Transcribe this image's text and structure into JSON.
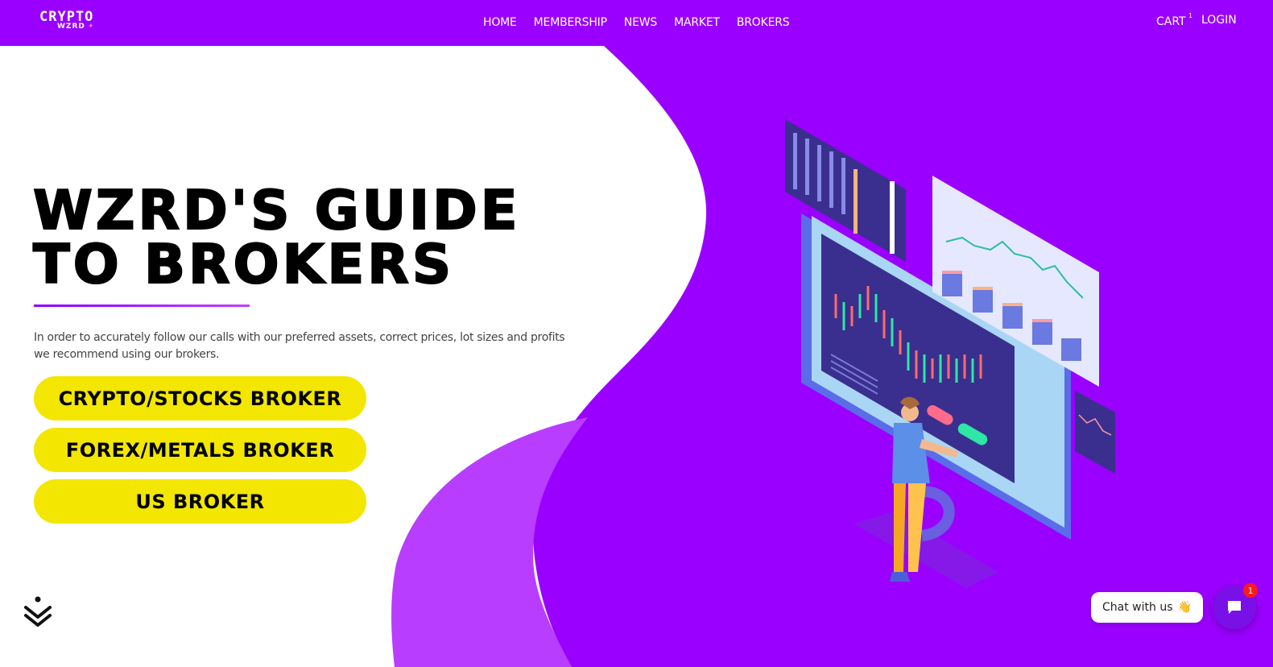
{
  "header": {
    "logo": {
      "line1": "CRYPTO",
      "line2": "WZRD"
    },
    "nav": [
      "HOME",
      "MEMBERSHIP",
      "NEWS",
      "MARKET",
      "BROKERS"
    ],
    "cart_label": "CART",
    "cart_count": "1",
    "login_label": "LOGIN"
  },
  "hero": {
    "title": "WZRD'S GUIDE\nTO BROKERS",
    "description": "In order to accurately follow our calls with our preferred assets, correct prices, lot sizes and profits we recommend using our brokers.",
    "buttons": [
      "CRYPTO/STOCKS BROKER",
      "FOREX/METALS BROKER",
      "US BROKER"
    ]
  },
  "chat": {
    "label": "Chat with us",
    "emoji": "👋",
    "badge": "1"
  },
  "colors": {
    "brand_purple": "#9a00ff",
    "button_yellow": "#f3e600",
    "light_purple": "#b83dff"
  }
}
